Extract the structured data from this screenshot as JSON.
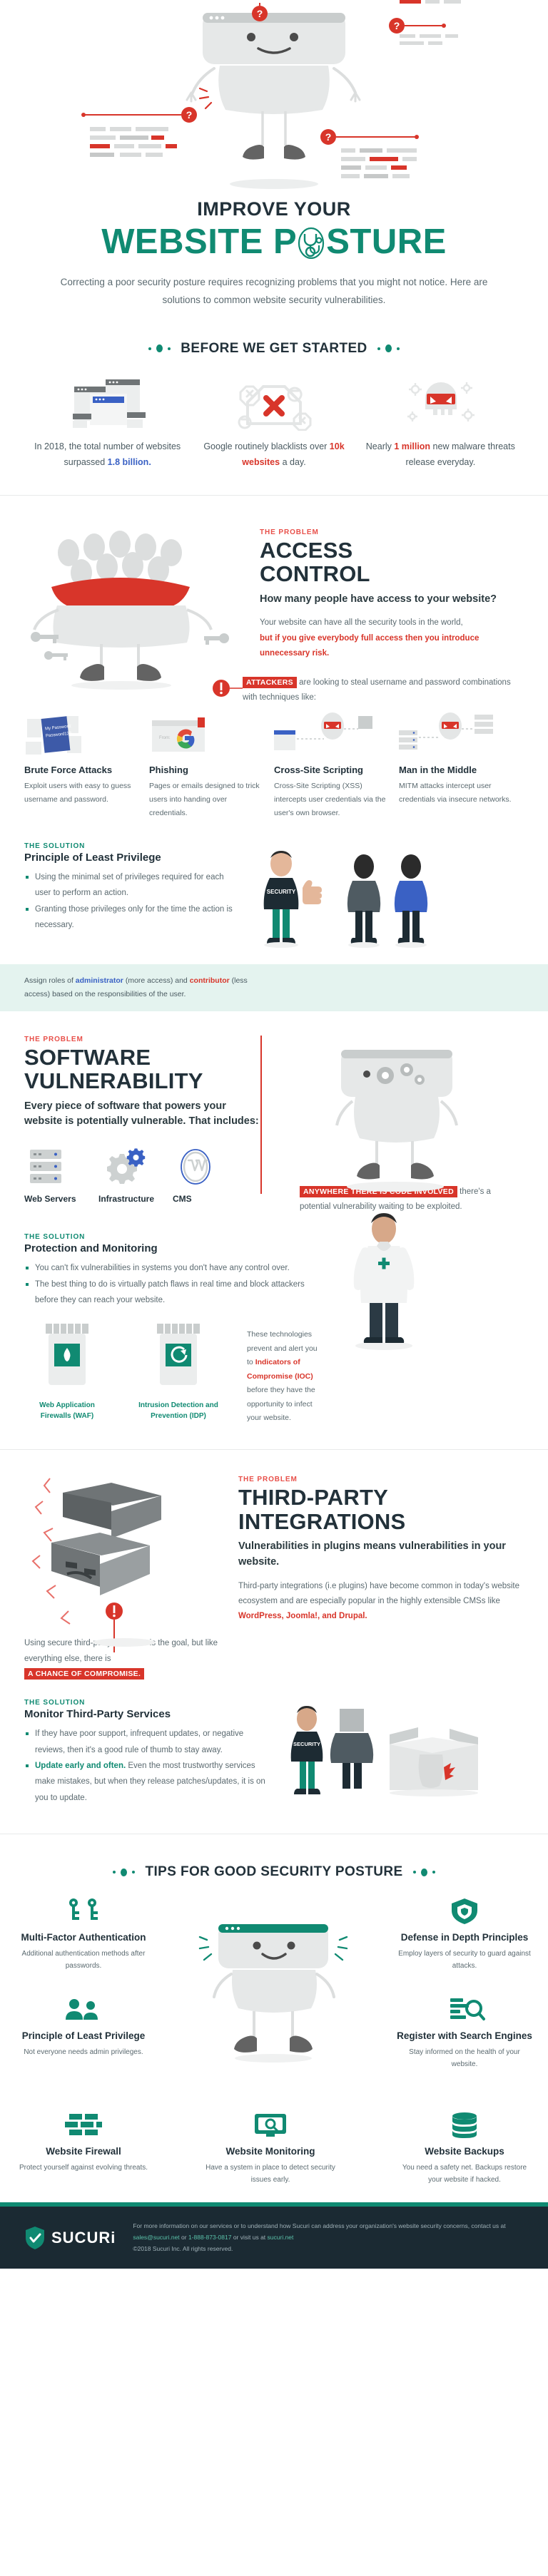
{
  "colors": {
    "teal": "#108a72",
    "red": "#d8352a",
    "dark": "#22313a",
    "blue": "#3a61c4",
    "band": "#e4f3ef"
  },
  "header": {
    "title_small": "IMPROVE YOUR",
    "title_large_a": "WEBSITE P",
    "title_large_b": "STURE",
    "intro": "Correcting a poor security posture requires recognizing problems that you might not notice. Here are solutions to common website security vulnerabilities."
  },
  "before": {
    "heading": "BEFORE WE GET STARTED",
    "stats": [
      {
        "icon": "browser-windows-icon",
        "parts": [
          {
            "t": "In 2018, the total number of websites surpassed ",
            "style": "normal"
          },
          {
            "t": "1.8 billion.",
            "style": "blue"
          }
        ]
      },
      {
        "icon": "red-x-blacklist-icon",
        "parts": [
          {
            "t": "Google routinely blacklists over ",
            "style": "normal"
          },
          {
            "t": "10k websites",
            "style": "red"
          },
          {
            "t": " a day.",
            "style": "normal"
          }
        ]
      },
      {
        "icon": "malware-skull-icon",
        "parts": [
          {
            "t": "Nearly ",
            "style": "normal"
          },
          {
            "t": "1 million",
            "style": "red"
          },
          {
            "t": " new malware threats release everyday.",
            "style": "normal"
          }
        ]
      }
    ]
  },
  "access_control": {
    "kicker": "THE PROBLEM",
    "title_line1": "ACCESS",
    "title_line2": "CONTROL",
    "subhead": "How many people have access to your website?",
    "body_normal": "Your website can have all the security tools in the world,",
    "body_red": "but if you give everybody full access then you introduce unnecessary risk.",
    "callout_tag": "ATTACKERS",
    "callout_text": "are looking to steal username and password combinations with techniques like:",
    "attacks": [
      {
        "icon": "password-note-icon",
        "title": "Brute Force Attacks",
        "desc": "Exploit users with easy to guess username and password.",
        "art_label": "My Password: Password123"
      },
      {
        "icon": "phishing-email-icon",
        "title": "Phishing",
        "desc": "Pages or emails designed to trick users into handing over credentials.",
        "art_label": "From:"
      },
      {
        "icon": "xss-browser-skull-icon",
        "title": "Cross-Site Scripting",
        "desc": "Cross-Site Scripting (XSS) intercepts user credentials via the user's own browser.",
        "art_label": ""
      },
      {
        "icon": "mitm-server-skull-icon",
        "title": "Man in the Middle",
        "desc": "MITM attacks intercept user credentials via insecure networks.",
        "art_label": ""
      }
    ],
    "solution": {
      "kicker": "THE SOLUTION",
      "title": "Principle of Least Privilege",
      "bullets": [
        "Using the minimal set of privileges required for each user to perform an action.",
        "Granting those privileges only for the time the action is necessary."
      ],
      "security_badge": "SECURITY"
    },
    "band": {
      "p1": "Assign roles of ",
      "admin": "administrator",
      "p2": " (more access) and ",
      "contrib": "contributor",
      "p3": " (less access) based on the responsibilities of the user."
    }
  },
  "software_vuln": {
    "kicker": "THE PROBLEM",
    "title_line1": "SOFTWARE",
    "title_line2": "VULNERABILITY",
    "subhead": "Every piece of software that powers your website is potentially vulnerable. That includes:",
    "includes": [
      {
        "icon": "server-stack-icon",
        "label": "Web Servers"
      },
      {
        "icon": "gears-icon",
        "label": "Infrastructure"
      },
      {
        "icon": "wordpress-icon",
        "label": "CMS"
      }
    ],
    "callout_tag": "ANYWHERE THERE IS CODE INVOLVED",
    "callout_text": "there's a potential vulnerability waiting to be exploited.",
    "solution": {
      "kicker": "THE SOLUTION",
      "title": "Protection and Monitoring",
      "bullets": [
        "You can't fix vulnerabilities in systems you don't have any control over.",
        "The best thing to do is virtually patch flaws in real time and block attackers before they can reach your website."
      ],
      "pills": [
        {
          "icon": "firewall-flame-icon",
          "caption": "Web Application Firewalls (WAF)"
        },
        {
          "icon": "intrusion-shield-icon",
          "caption": "Intrusion Detection and Prevention (IDP)"
        }
      ],
      "note_p1": "These technologies prevent and alert you to ",
      "note_red": "Indicators of Compromise (IOC)",
      "note_p2": " before they have the opportunity to infect your website."
    }
  },
  "third_party": {
    "kicker": "THE PROBLEM",
    "title_line1": "THIRD-PARTY",
    "title_line2": "INTEGRATIONS",
    "subhead": "Vulnerabilities in plugins means vulnerabilities in your website.",
    "body_p1": "Third-party integrations (i.e plugins) have become common in today's website ecosystem and are especially popular in the highly extensible CMSs like ",
    "body_red": "WordPress, Joomla!, and Drupal.",
    "caption_p1": "Using secure third-party providers is the goal, but like everything else, there is ",
    "caption_tag": "A CHANCE OF COMPROMISE.",
    "solution": {
      "kicker": "THE SOLUTION",
      "title": "Monitor Third-Party Services",
      "bullet1": "If they have poor support, infrequent updates, or negative reviews, then it's a good rule of thumb to stay away.",
      "bullet2_bold": "Update early and often.",
      "bullet2_rest": " Even the most trustworthy services make mistakes, but when they release patches/updates, it is on you to update.",
      "security_badge": "SECURITY"
    }
  },
  "tips": {
    "heading": "TIPS FOR GOOD SECURITY POSTURE",
    "items": [
      {
        "icon": "mfa-key-icon",
        "title": "Multi-Factor Authentication",
        "desc": "Additional authentication methods after passwords."
      },
      {
        "icon": "shield-layers-icon",
        "title": "Defense in Depth Principles",
        "desc": "Employ layers of security to guard against attacks."
      },
      {
        "icon": "users-privilege-icon",
        "title": "Principle of Least Privilege",
        "desc": "Not everyone needs admin privileges."
      },
      {
        "icon": "search-engine-icon",
        "title": "Register with Search Engines",
        "desc": "Stay informed on the health of your website."
      },
      {
        "icon": "firewall-brick-icon",
        "title": "Website Firewall",
        "desc": "Protect yourself against evolving threats."
      },
      {
        "icon": "monitoring-eye-icon",
        "title": "Website Monitoring",
        "desc": "Have a system in place to detect security issues early."
      },
      {
        "icon": "backup-database-icon",
        "title": "Website Backups",
        "desc": "You need a safety net. Backups restore your website if hacked."
      }
    ]
  },
  "footer": {
    "brand": "SUCURi",
    "logo_icon": "sucuri-shield-icon",
    "text_p1": "For more information on our services or to understand how Sucuri can address your organization's website security concerns, contact us at ",
    "email": "sales@sucuri.net",
    "text_p2": " or ",
    "phone": "1-888-873-0817",
    "text_p3": " or visit us at ",
    "site": "sucuri.net",
    "copyright": "©2018 Sucuri Inc. All rights reserved."
  }
}
